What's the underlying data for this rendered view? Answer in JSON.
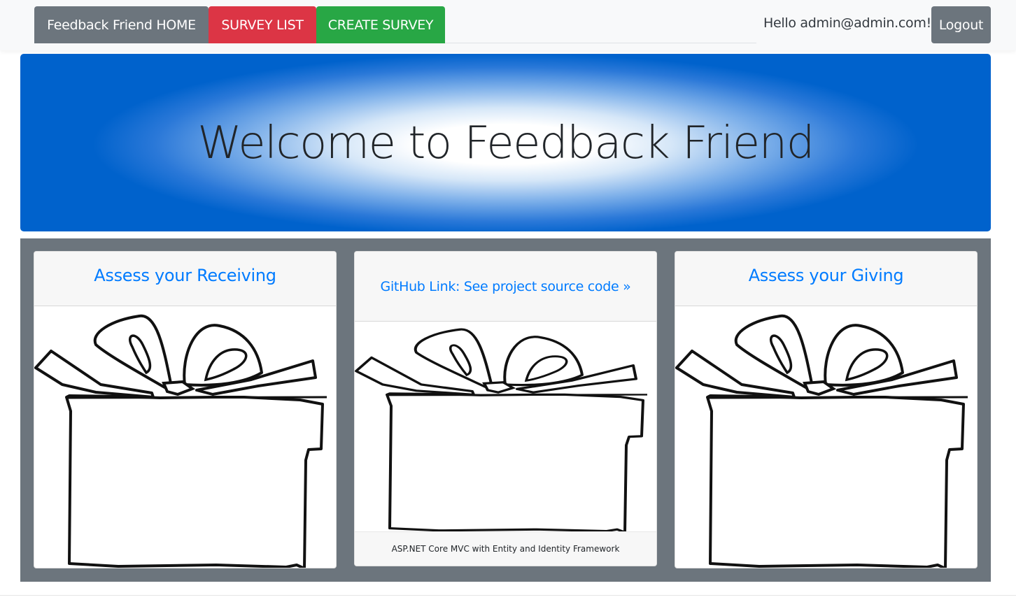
{
  "navbar": {
    "home_label": "Feedback Friend HOME",
    "survey_list_label": "SURVEY LIST",
    "create_survey_label": "CREATE SURVEY",
    "greeting": "Hello admin@admin.com!",
    "logout_label": "Logout"
  },
  "jumbotron": {
    "title": "Welcome to Feedback Friend"
  },
  "cards": [
    {
      "link_text": "Assess your Receiving",
      "image": "gift-box-icon"
    },
    {
      "link_text": "GitHub Link: See project source code »",
      "image": "gift-box-icon",
      "footer": "ASP.NET Core MVC with Entity and Identity Framework"
    },
    {
      "link_text": "Assess your Giving",
      "image": "gift-box-icon"
    }
  ],
  "colors": {
    "home": "#6c757d",
    "survey_list": "#dc3545",
    "create_survey": "#28a745",
    "logout": "#6c757d",
    "jumbotron": "#0062cc",
    "panel": "#6c757d",
    "link": "#007bff"
  }
}
